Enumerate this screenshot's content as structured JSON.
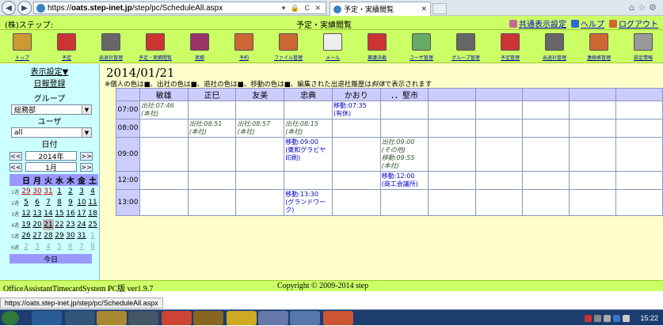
{
  "browser": {
    "url_domain": "oats.step-inet.jp",
    "url_path": "/step/pc/ScheduleAll.aspx",
    "url_prefix": "https://",
    "tab_title": "予定・実績閲覧",
    "status_url": "https://oats.step-inet.jp/step/pc/ScheduleAll.aspx"
  },
  "header": {
    "company": "(株)ステップ:",
    "title": "予定・実績閲覧",
    "links": [
      {
        "label": "共通表示設定",
        "icon": "settings-icon",
        "color": "#cc6699"
      },
      {
        "label": "ヘルプ",
        "icon": "help-icon",
        "color": "#3366cc"
      },
      {
        "label": "ログアウト",
        "icon": "logout-icon",
        "color": "#cc6633"
      }
    ]
  },
  "toolbar": [
    {
      "label": "トップ",
      "icon": "top-icon",
      "color": "#cc9933"
    },
    {
      "label": "予定",
      "icon": "schedule-icon",
      "color": "#cc3333"
    },
    {
      "label": "出退社管理",
      "icon": "attendance-icon",
      "color": "#666666"
    },
    {
      "label": "予定・実績閲覧",
      "icon": "schedule-view-icon",
      "color": "#cc3333"
    },
    {
      "label": "実績",
      "icon": "results-icon",
      "color": "#993366"
    },
    {
      "label": "予約",
      "icon": "reservation-icon",
      "color": "#cc6633"
    },
    {
      "label": "ファイル管理",
      "icon": "file-icon",
      "color": "#cc6633"
    },
    {
      "label": "メール",
      "icon": "mail-icon",
      "color": "#eeeeee"
    },
    {
      "label": "稟議決裁",
      "icon": "approval-icon",
      "color": "#cc3333"
    },
    {
      "label": "ユーザ管理",
      "icon": "user-icon",
      "color": "#66aa66"
    },
    {
      "label": "グループ管理",
      "icon": "group-icon",
      "color": "#666666"
    },
    {
      "label": "予定管理",
      "icon": "schedule-admin-icon",
      "color": "#cc3333"
    },
    {
      "label": "出退社管理",
      "icon": "attendance-admin-icon",
      "color": "#666666"
    },
    {
      "label": "連絡帳管理",
      "icon": "contacts-icon",
      "color": "#cc6633"
    },
    {
      "label": "設定情報",
      "icon": "tools-icon",
      "color": "#999999"
    }
  ],
  "sidebar": {
    "display_settings": "表示設定▼",
    "daily_report": "日報登録",
    "group_label": "グループ",
    "group_value": "総務部",
    "user_label": "ユーザ",
    "user_value": "all",
    "date_label": "日付",
    "year": "2014年",
    "month": "1月",
    "prev": "<<",
    "next": ">>",
    "today": "今日",
    "weekdays": [
      "日",
      "月",
      "火",
      "水",
      "木",
      "金",
      "土"
    ],
    "weeks": [
      {
        "w": "1週",
        "days": [
          "29",
          "30",
          "31",
          "1",
          "2",
          "3",
          "4"
        ]
      },
      {
        "w": "2週",
        "days": [
          "5",
          "6",
          "7",
          "8",
          "9",
          "10",
          "11"
        ]
      },
      {
        "w": "3週",
        "days": [
          "12",
          "13",
          "14",
          "15",
          "16",
          "17",
          "18"
        ]
      },
      {
        "w": "4週",
        "days": [
          "19",
          "20",
          "21",
          "22",
          "23",
          "24",
          "25"
        ]
      },
      {
        "w": "5週",
        "days": [
          "26",
          "27",
          "28",
          "29",
          "30",
          "31",
          "1"
        ]
      },
      {
        "w": "6週",
        "days": [
          "2",
          "3",
          "4",
          "5",
          "6",
          "7",
          "8"
        ]
      }
    ]
  },
  "main": {
    "date": "2014/01/21",
    "note": "※個人の色は■、出社の色は■、退社の色は■、移動の色は■、編集された出退社履歴は",
    "note_em": "斜体",
    "note_tail": "で表示されます",
    "columns": [
      "敏雄",
      "正巳",
      "友美",
      "忠典",
      "かおり",
      "．．堅市",
      "",
      "",
      "",
      "",
      ""
    ],
    "rows": [
      {
        "time": "07:00",
        "cells": [
          {
            "col": 0,
            "text": "出社:07:46\n(本社)",
            "type": "att"
          },
          {
            "col": 4,
            "text": "移動:07:35\n(有休)",
            "type": "move"
          }
        ]
      },
      {
        "time": "08:00",
        "cells": [
          {
            "col": 1,
            "text": "出社:08:51\n(本社)",
            "type": "att"
          },
          {
            "col": 2,
            "text": "出社:08:57\n(本社)",
            "type": "att"
          },
          {
            "col": 3,
            "text": "出社:08:15\n(本社)",
            "type": "att"
          }
        ]
      },
      {
        "time": "09:00",
        "cells": [
          {
            "col": 3,
            "text": "移動:09:00\n(東和グラビヤ印刷)",
            "type": "move"
          },
          {
            "col": 5,
            "text": "出社:09:00\n(その他)\n移動:09:55\n(本社)",
            "type": "mixed"
          }
        ]
      },
      {
        "time": "12:00",
        "cells": [
          {
            "col": 5,
            "text": "移動:12:00\n(商工会議所)",
            "type": "move"
          }
        ]
      },
      {
        "time": "13:00",
        "cells": [
          {
            "col": 3,
            "text": "移動:13:30\n(グランドワーク)",
            "type": "move"
          }
        ]
      }
    ]
  },
  "footer": {
    "version": "OfficeAssistantTimecardSystem PC版 ver1.9.7",
    "copyright": "Copyright © 2009-2014 step"
  },
  "taskbar": {
    "clock": "15:22"
  }
}
